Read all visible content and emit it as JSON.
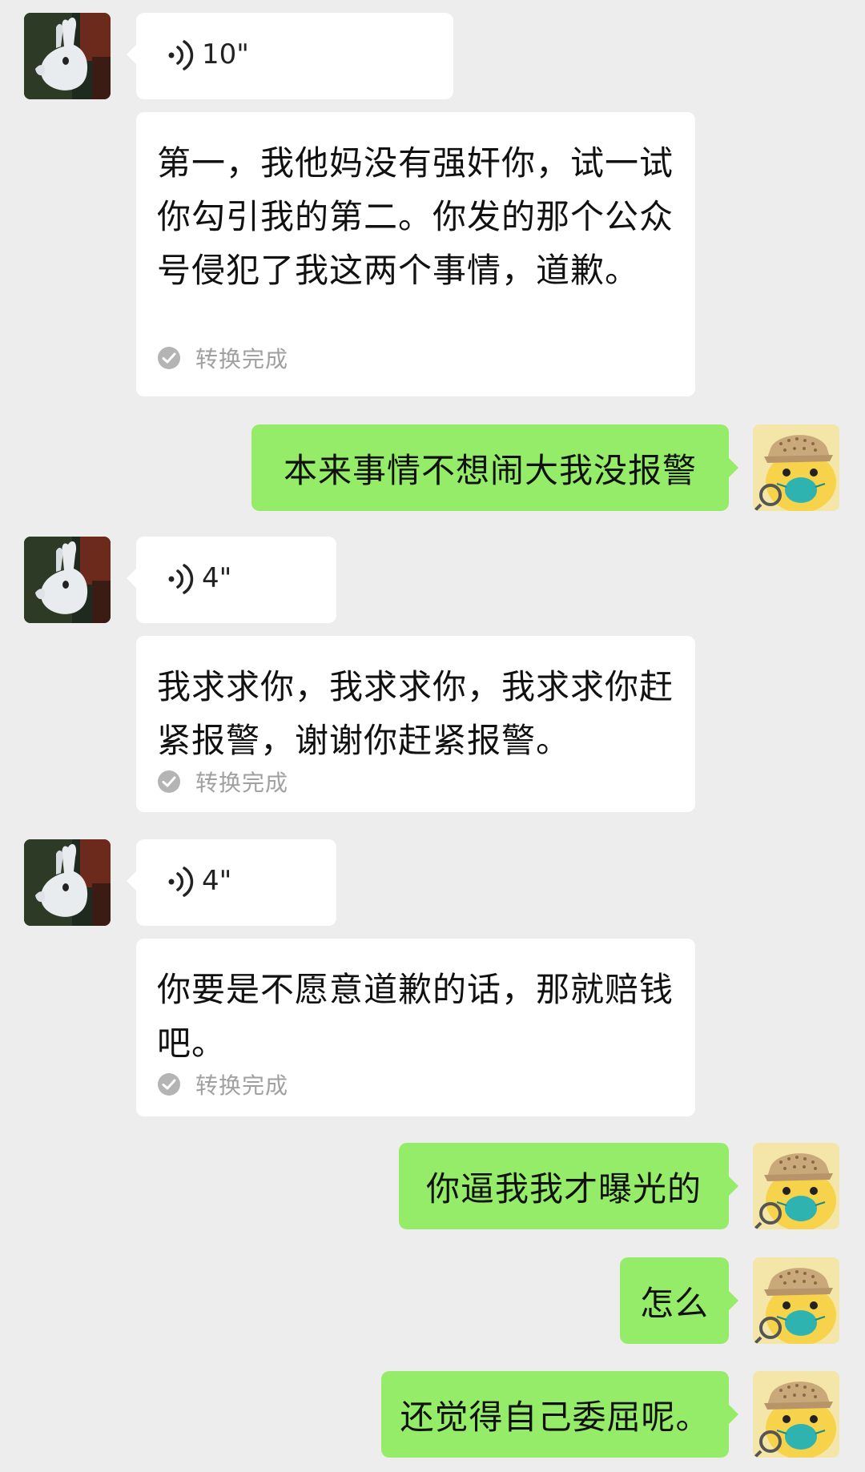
{
  "chat": {
    "messages": [
      {
        "type": "voice",
        "duration": "10\""
      },
      {
        "type": "transcript",
        "text": "第一，我他妈没有强奸你，试一试你勾引我的第二。你发的那个公众号侵犯了我这两个事情，道歉。",
        "status": "转换完成"
      },
      {
        "type": "sent",
        "text": "本来事情不想闹大我没报警"
      },
      {
        "type": "voice",
        "duration": "4\""
      },
      {
        "type": "transcript",
        "text": "我求求你，我求求你，我求求你赶紧报警，谢谢你赶紧报警。",
        "status": "转换完成"
      },
      {
        "type": "voice",
        "duration": "4\""
      },
      {
        "type": "transcript",
        "text": "你要是不愿意道歉的话，那就赔钱吧。",
        "status": "转换完成"
      },
      {
        "type": "sent",
        "text": "你逼我我才曝光的"
      },
      {
        "type": "sent",
        "text": "怎么"
      },
      {
        "type": "sent",
        "text": "还觉得自己委屈呢。"
      }
    ]
  },
  "colors": {
    "background": "#ededed",
    "incoming_bubble": "#ffffff",
    "outgoing_bubble": "#95ec69",
    "status_text": "#a0a0a0"
  },
  "icons": {
    "voice": "voice-wave-icon",
    "status": "check-circle-icon",
    "contact_avatar": "rabbit-avatar",
    "self_avatar": "pikachu-detective-avatar"
  }
}
